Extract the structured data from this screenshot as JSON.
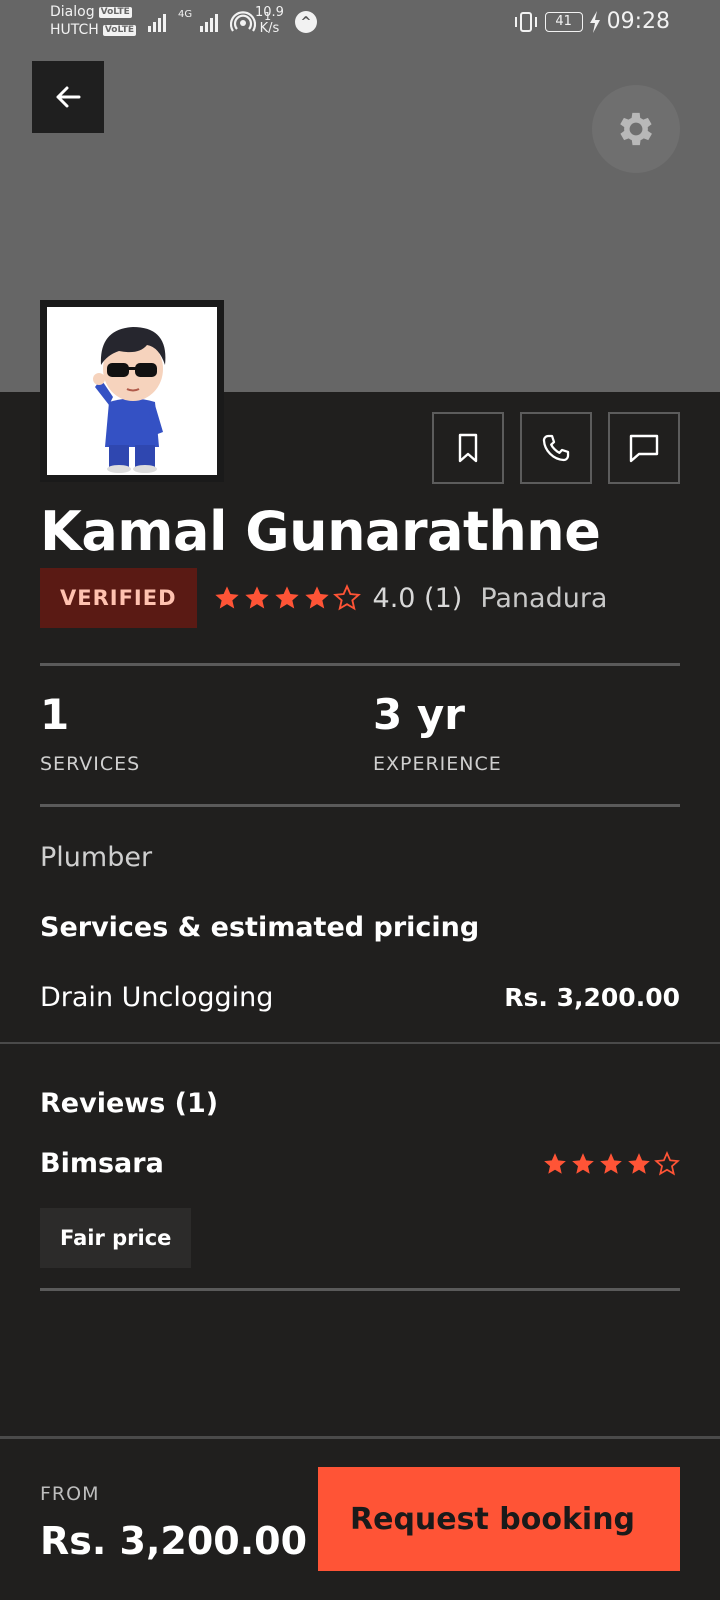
{
  "status_bar": {
    "carrier1": "Dialog",
    "carrier2": "HUTCH",
    "volte": "VoLTE",
    "net_type": "4G",
    "net_speed_value": "10.9",
    "net_speed_unit": "K/s",
    "hotspot_count": "1",
    "battery": "41",
    "time": "09:28"
  },
  "profile": {
    "name": "Kamal Gunarathne",
    "verified_label": "VERIFIED",
    "rating_value": 4,
    "rating_text": "4.0 (1)",
    "location": "Panadura"
  },
  "stats": {
    "services_value": "1",
    "services_label": "SERVICES",
    "experience_value": "3 yr",
    "experience_label": "EXPERIENCE"
  },
  "category": "Plumber",
  "services_section": {
    "title": "Services & estimated pricing",
    "items": [
      {
        "name": "Drain Unclogging",
        "price": "Rs. 3,200.00"
      }
    ]
  },
  "reviews": {
    "title": "Reviews (1)",
    "items": [
      {
        "reviewer": "Bimsara",
        "rating": 4,
        "tag": "Fair price"
      }
    ]
  },
  "footer": {
    "from_label": "FROM",
    "from_price": "Rs. 3,200.00",
    "book_label": "Request booking"
  },
  "colors": {
    "accent": "#ff5436",
    "verified_bg": "#5a1a14",
    "background": "#201f1e",
    "cover": "#666666"
  },
  "icons": [
    "back-arrow-icon",
    "gear-icon",
    "bookmark-icon",
    "phone-icon",
    "chat-icon",
    "star-icon"
  ]
}
